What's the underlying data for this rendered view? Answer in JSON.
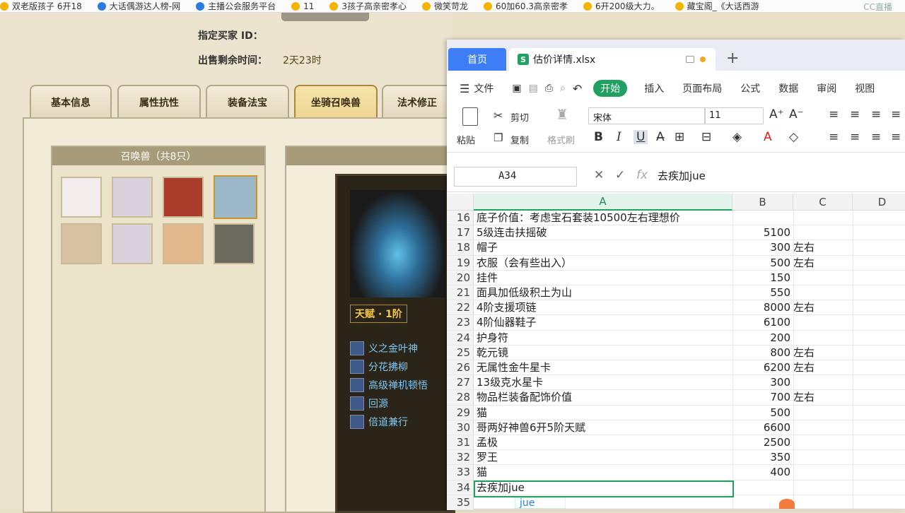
{
  "bookmarks": [
    {
      "label": "双老版孩子 6开18",
      "icon": "star-folder-icon"
    },
    {
      "label": "大话偶游达人榜-网",
      "icon": "globe-icon"
    },
    {
      "label": "主播公会服务平台",
      "icon": "globe-icon"
    },
    {
      "label": "11",
      "icon": "game-icon"
    },
    {
      "label": "3孩子高亲密孝心",
      "icon": "star-folder-icon"
    },
    {
      "label": "微笑苛龙",
      "icon": "star-folder-icon"
    },
    {
      "label": "60加60.3高亲密孝",
      "icon": "star-folder-icon"
    },
    {
      "label": "6开200级大力。",
      "icon": "star-folder-icon"
    },
    {
      "label": "藏宝阁_《大话西游",
      "icon": "star-folder-icon"
    }
  ],
  "watermark": "CC直播",
  "game": {
    "buyer_label": "指定买家 ID：",
    "time_label": "出售剩余时间：",
    "time_value": "2天23时",
    "tabs": [
      "基本信息",
      "属性抗性",
      "装备法宝",
      "坐骑召唤兽",
      "法术修正"
    ],
    "active_tab": 3,
    "summon_header": "召唤兽（共8只）",
    "talent": "天赋 · 1阶",
    "skills": [
      "义之金叶神",
      "分花拂柳",
      "高级禅机顿悟",
      "回源",
      "倍道兼行"
    ]
  },
  "wps": {
    "home_tab": "首页",
    "file_tab": "估价详情.xlsx",
    "menu": [
      "文件",
      "开始",
      "插入",
      "页面布局",
      "公式",
      "数据",
      "审阅",
      "视图"
    ],
    "ribbon": {
      "paste": "粘贴",
      "cut": "剪切",
      "copy": "复制",
      "format_painter": "格式刷",
      "font": "宋体",
      "size": "11"
    },
    "namebox": "A34",
    "formula": "去疾加jue",
    "columns": [
      "A",
      "B",
      "C",
      "D"
    ],
    "rows": [
      {
        "n": "16",
        "a": "底子价值：考虑宝石套装10500左右理想价",
        "b": "",
        "c": ""
      },
      {
        "n": "17",
        "a": "5级连击扶摇破",
        "b": "5100",
        "c": ""
      },
      {
        "n": "18",
        "a": "帽子",
        "b": "300",
        "c": "左右"
      },
      {
        "n": "19",
        "a": "衣服（会有些出入）",
        "b": "500",
        "c": "左右"
      },
      {
        "n": "20",
        "a": "挂件",
        "b": "150",
        "c": ""
      },
      {
        "n": "21",
        "a": "面具加低级积土为山",
        "b": "550",
        "c": ""
      },
      {
        "n": "22",
        "a": "4阶支援项链",
        "b": "8000",
        "c": "左右"
      },
      {
        "n": "23",
        "a": "4阶仙器鞋子",
        "b": "6100",
        "c": ""
      },
      {
        "n": "24",
        "a": "护身符",
        "b": "200",
        "c": ""
      },
      {
        "n": "25",
        "a": "乾元镜",
        "b": "800",
        "c": "左右"
      },
      {
        "n": "26",
        "a": "无属性金牛星卡",
        "b": "6200",
        "c": "左右"
      },
      {
        "n": "27",
        "a": "13级克水星卡",
        "b": "300",
        "c": ""
      },
      {
        "n": "28",
        "a": "物品栏装备配饰价值",
        "b": "700",
        "c": "左右"
      },
      {
        "n": "29",
        "a": "猫",
        "b": "500",
        "c": ""
      },
      {
        "n": "30",
        "a": "哥两好神兽6开5阶天赋",
        "b": "6600",
        "c": ""
      },
      {
        "n": "31",
        "a": "孟极",
        "b": "2500",
        "c": ""
      },
      {
        "n": "32",
        "a": "罗王",
        "b": "350",
        "c": ""
      },
      {
        "n": "33",
        "a": "猫",
        "b": "400",
        "c": ""
      },
      {
        "n": "34",
        "a": "去疾加jue",
        "b": "",
        "c": ""
      },
      {
        "n": "35",
        "a": "",
        "b": "",
        "c": ""
      }
    ],
    "ime_text": "jue"
  }
}
